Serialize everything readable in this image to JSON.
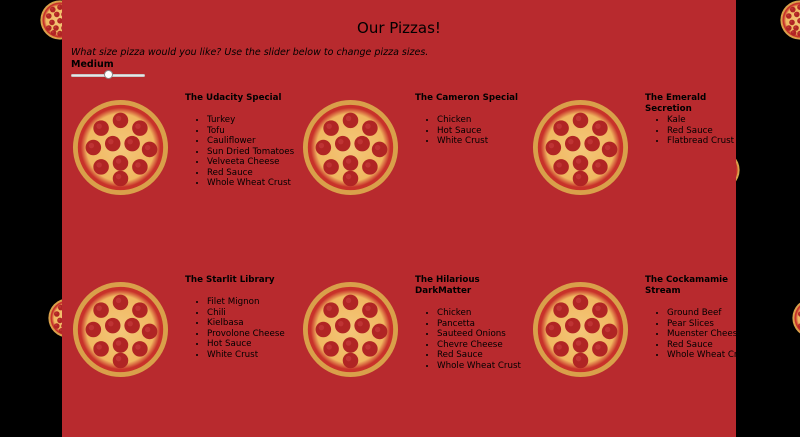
{
  "page": {
    "title": "Our Pizzas!",
    "size_prompt": "What size pizza would you like? Use the slider below to change pizza sizes.",
    "size_value": "Medium",
    "slider_fraction": 0.5
  },
  "colors": {
    "page_background": "#b82a2e",
    "outer_background": "#000000",
    "crust": "#d9a04a",
    "sauce": "#c8322a",
    "cheese": "#f4c77a",
    "pepperoni": "#b02524"
  },
  "icons": {
    "pizza": "pizza-icon",
    "background_pizza": "pepperoni-pizza-icon"
  },
  "pizzas": [
    {
      "name": "The Udacity Special",
      "ingredients": [
        "Turkey",
        "Tofu",
        "Cauliflower",
        "Sun Dried Tomatoes",
        "Velveeta Cheese",
        "Red Sauce",
        "Whole Wheat Crust"
      ]
    },
    {
      "name": "The Cameron Special",
      "ingredients": [
        "Chicken",
        "Hot Sauce",
        "White Crust"
      ]
    },
    {
      "name": "The Emerald Secretion",
      "ingredients": [
        "Kale",
        "Red Sauce",
        "Flatbread Crust"
      ]
    },
    {
      "name": "The Starlit Library",
      "ingredients": [
        "Filet Mignon",
        "Chili",
        "Kielbasa",
        "Provolone Cheese",
        "Hot Sauce",
        "White Crust"
      ]
    },
    {
      "name": "The Hilarious DarkMatter",
      "ingredients": [
        "Chicken",
        "Pancetta",
        "Sauteed Onions",
        "Chevre Cheese",
        "Red Sauce",
        "Whole Wheat Crust"
      ]
    },
    {
      "name": "The Cockamamie Stream",
      "ingredients": [
        "Ground Beef",
        "Pear Slices",
        "Muenster Cheese",
        "Red Sauce",
        "Whole Wheat Crust"
      ]
    }
  ]
}
